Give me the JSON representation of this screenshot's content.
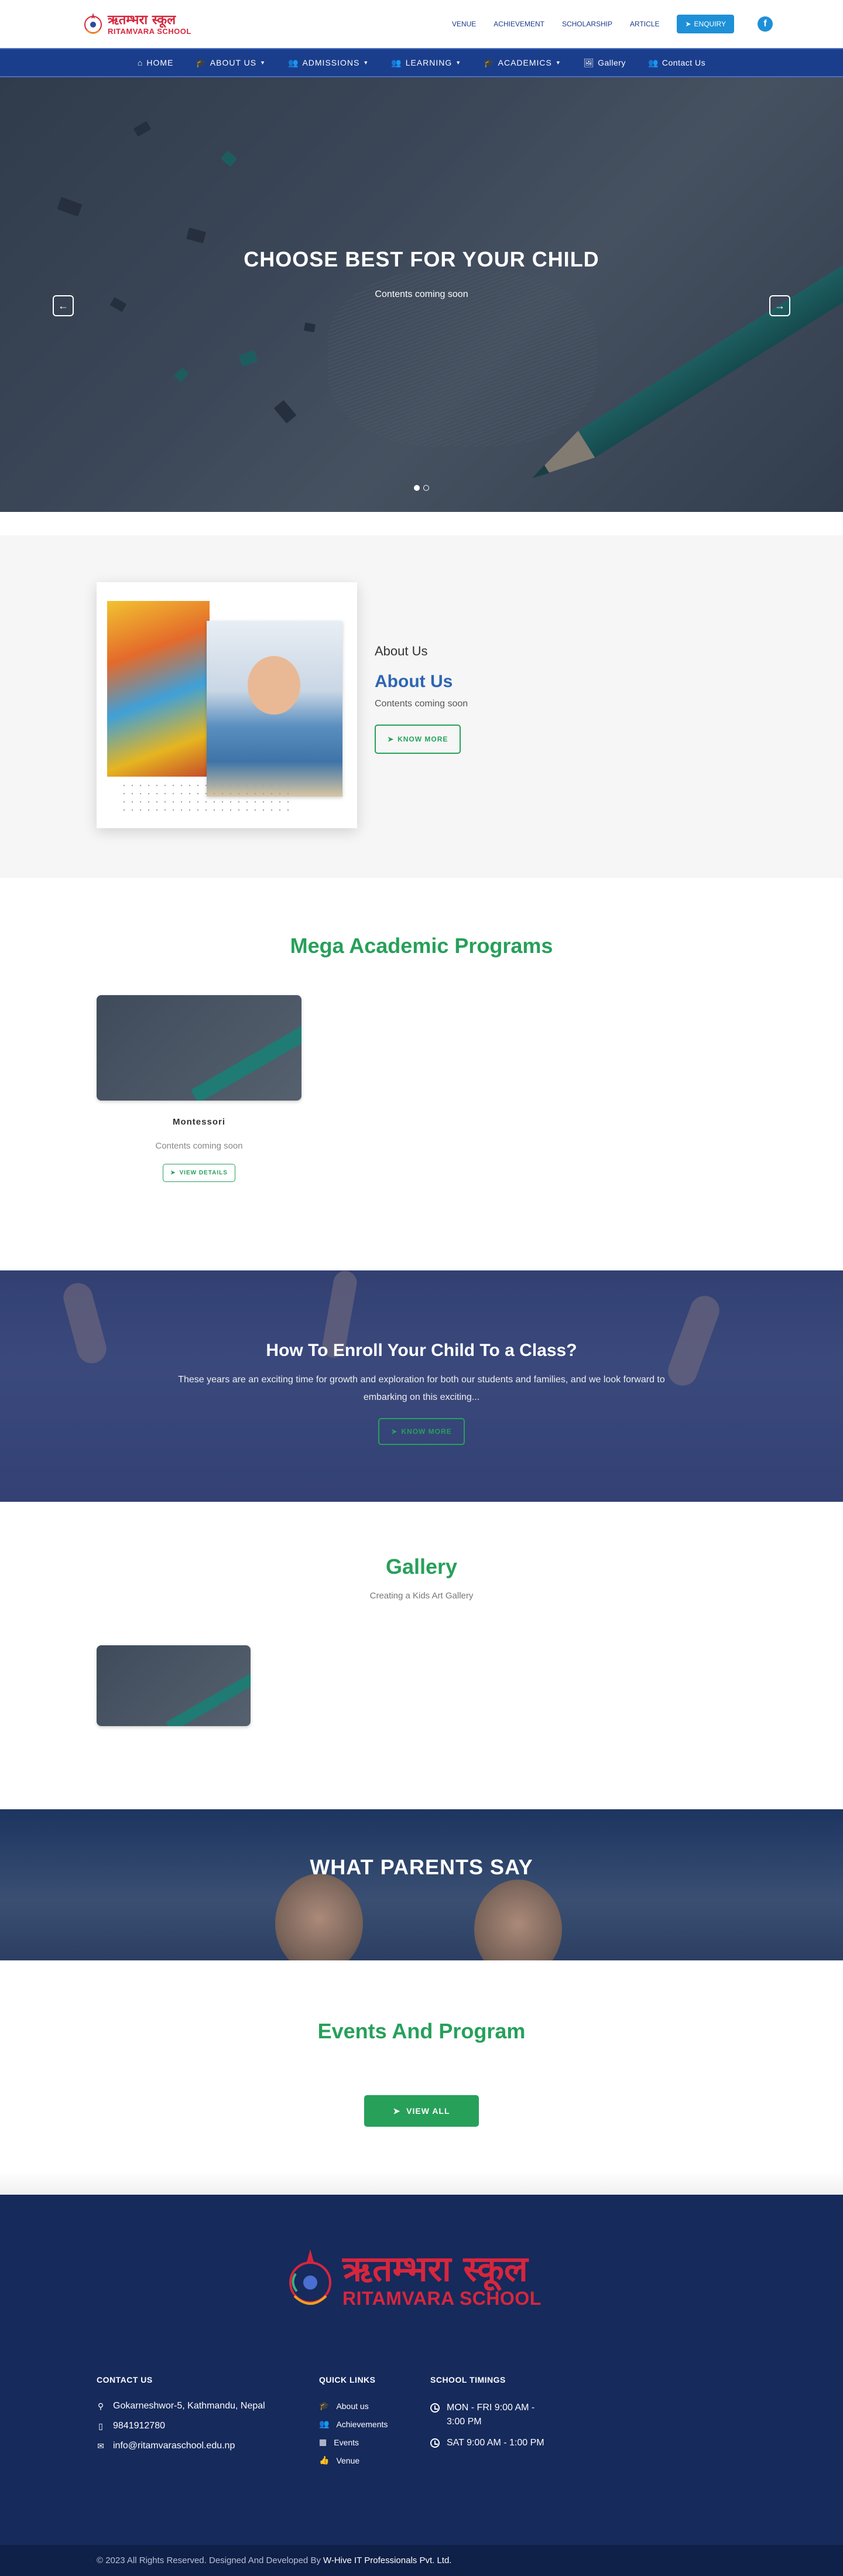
{
  "brand": {
    "name_hindi": "ऋतम्भरा स्कूल",
    "name_english": "RITAMVARA SCHOOL"
  },
  "topbar": {
    "links": [
      "VENUE",
      "ACHIEVEMENT",
      "SCHOLARSHIP",
      "ARTICLE"
    ],
    "enquiry_label": "ENQUIRY",
    "facebook_label": "f"
  },
  "nav": {
    "items": [
      {
        "label": "HOME",
        "icon": "home-icon",
        "dropdown": false
      },
      {
        "label": "ABOUT US",
        "icon": "graduation-cap-icon",
        "dropdown": true
      },
      {
        "label": "ADMISSIONS",
        "icon": "users-icon",
        "dropdown": true
      },
      {
        "label": "LEARNING",
        "icon": "users-icon",
        "dropdown": true
      },
      {
        "label": "ACADEMICS",
        "icon": "graduation-cap-icon",
        "dropdown": true
      },
      {
        "label": "Gallery",
        "icon": "image-icon",
        "dropdown": false
      },
      {
        "label": "Contact Us",
        "icon": "users-icon",
        "dropdown": false
      }
    ]
  },
  "hero": {
    "title": "CHOOSE BEST FOR YOUR CHILD",
    "subtitle": "Contents coming soon",
    "slide_count": 2,
    "active_slide": 1
  },
  "about": {
    "label": "About Us",
    "heading": "About Us",
    "body": "Contents coming soon",
    "button": "KNOW MORE"
  },
  "programs": {
    "title": "Mega Academic Programs",
    "items": [
      {
        "name": "Montessori",
        "desc": "Contents coming soon",
        "button": "VIEW DETAILS"
      }
    ]
  },
  "enroll": {
    "title": "How To Enroll Your Child To a Class?",
    "body": "These years are an exciting time for growth and exploration for both our students and families, and we look forward to embarking on this exciting...",
    "button": "KNOW MORE"
  },
  "gallery": {
    "title": "Gallery",
    "subtitle": "Creating a Kids Art Gallery"
  },
  "parents": {
    "title": "WHAT PARENTS SAY"
  },
  "events": {
    "title": "Events And Program",
    "button": "VIEW ALL"
  },
  "footer": {
    "contact": {
      "heading": "CONTACT US",
      "address": "Gokarneshwor-5, Kathmandu, Nepal",
      "phone": "9841912780",
      "email": "info@ritamvaraschool.edu.np"
    },
    "quick_links": {
      "heading": "QUICK LINKS",
      "items": [
        "About us",
        "Achievements",
        "Events",
        "Venue"
      ]
    },
    "timings": {
      "heading": "SCHOOL TIMINGS",
      "items": [
        "MON - FRI 9:00 AM - 3:00 PM",
        "SAT 9:00 AM - 1:00 PM"
      ]
    },
    "copyright": "© 2023 All Rights Reserved. Designed And Developed By",
    "developer": "W-Hive IT Professionals Pvt. Ltd."
  },
  "colors": {
    "nav_blue": "#1b3e8c",
    "accent_green": "#27a05a",
    "link_blue": "#1e90d8",
    "footer_navy": "#162a5c",
    "brand_red": "#d7263d"
  }
}
